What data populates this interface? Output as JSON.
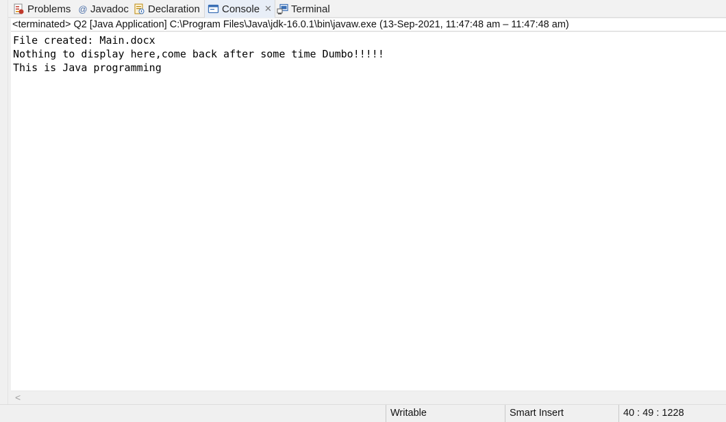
{
  "tabs": [
    {
      "label": "Problems",
      "icon": "problems-icon"
    },
    {
      "label": "Javadoc",
      "icon": "javadoc-icon"
    },
    {
      "label": "Declaration",
      "icon": "declaration-icon"
    },
    {
      "label": "Console",
      "icon": "console-icon",
      "active": true,
      "close": "✕"
    },
    {
      "label": "Terminal",
      "icon": "terminal-icon"
    }
  ],
  "console": {
    "status": "<terminated> Q2 [Java Application] C:\\Program Files\\Java\\jdk-16.0.1\\bin\\javaw.exe  (13-Sep-2021, 11:47:48 am – 11:47:48 am)",
    "lines": [
      "File created: Main.docx",
      "Nothing to display here,come back after some time Dumbo!!!!!",
      "This is Java programming"
    ]
  },
  "scrollbar": {
    "left_arrow": "<"
  },
  "statusbar": {
    "writable": "Writable",
    "insert_mode": "Smart Insert",
    "position": "40 : 49 : 1228"
  },
  "colors": {
    "accent": "#3a6fb5",
    "active_tab_bg": "#e8eef7",
    "problems_red": "#c0392b"
  }
}
